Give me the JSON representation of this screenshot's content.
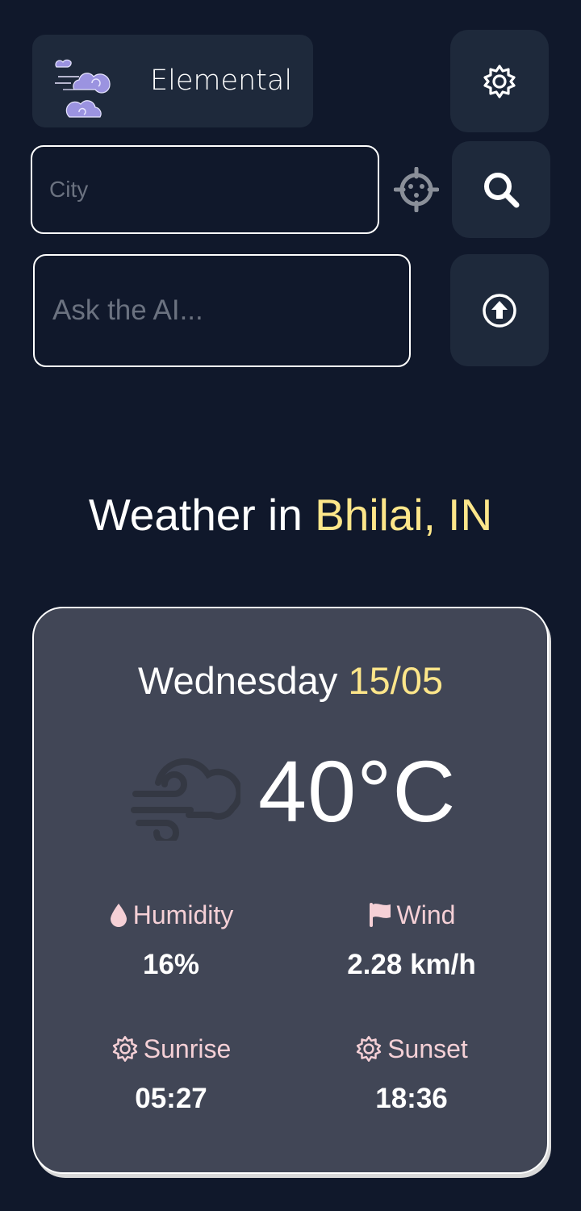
{
  "app": {
    "name": "Elemental"
  },
  "search": {
    "city_placeholder": "City",
    "city_value": ""
  },
  "ai": {
    "placeholder": "Ask the AI...",
    "value": ""
  },
  "heading": {
    "prefix": "Weather in",
    "location": "Bhilai, IN"
  },
  "forecast": {
    "day": "Wednesday",
    "date": "15/05",
    "temperature": "40°C",
    "condition_icon": "wind-cloud-icon",
    "stats": {
      "humidity": {
        "label": "Humidity",
        "value": "16%",
        "icon": "droplet-icon"
      },
      "wind": {
        "label": "Wind",
        "value": "2.28 km/h",
        "icon": "flag-icon"
      },
      "sunrise": {
        "label": "Sunrise",
        "value": "05:27",
        "icon": "sun-icon"
      },
      "sunset": {
        "label": "Sunset",
        "value": "18:36",
        "icon": "sun-icon"
      }
    }
  },
  "colors": {
    "background": "#10182b",
    "panel": "#1e293b",
    "card": "#414656",
    "accent": "#fde68a",
    "label": "#f5d0d6",
    "logo": "#9b93e0"
  }
}
